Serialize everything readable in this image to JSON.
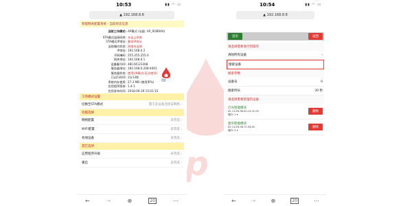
{
  "phone1": {
    "time": "10:53",
    "url": "192.168.8.8",
    "title": "智能网关配置系统 - 当前状态信息",
    "mode_label": "当前工作模式:",
    "mode_value": "AP模式 (长配: AP_ROBRA0)",
    "kv": [
      {
        "k": "STA模式连接网关:",
        "v": "未连上网关",
        "red": true
      },
      {
        "k": "STA模式IP地址:",
        "v": "静态IP地址",
        "red": true
      },
      {
        "k": "当前端口状态:",
        "v": "网络未连接",
        "red": true
      },
      {
        "k": "IP地址:",
        "v": "192.168.0.2",
        "red": false
      },
      {
        "k": "子网掩码:",
        "v": "255.255.255.0",
        "red": false
      },
      {
        "k": "网关地址:",
        "v": "192.168.0.1",
        "red": false
      },
      {
        "k": "设备编号ID:",
        "v": "48C44123308",
        "red": false
      },
      {
        "k": "服务器地址:",
        "v": "192.168.0.248:4001",
        "red": false
      },
      {
        "k": "服务器状态:",
        "v": "使用UN模式(无法使用)",
        "red": true
      },
      {
        "k": "已运行时间:",
        "v": "2分13秒",
        "red": false
      },
      {
        "k": "系统内存使用:",
        "v": "27.3 MB (使用率%)",
        "red": false
      },
      {
        "k": "应用程序版本:",
        "v": "1.4-1",
        "red": false
      },
      {
        "k": "应用发布时间:",
        "v": "2018-06-19 15:01:15",
        "red": false
      }
    ],
    "sec_work": "工作模式设置",
    "switch_label": "切换至STA模式",
    "switch_value": "需于此设备连接该网络 ›",
    "sec_func": "功能选择",
    "func_rows": [
      {
        "label": "网络配置",
        "value": "未完成 ›"
      },
      {
        "label": "WIFI配置",
        "value": "未完成 ›"
      },
      {
        "label": "有线设备",
        "value": "未完成 ›"
      }
    ],
    "sec_other": "其它选项",
    "other_rows": [
      {
        "label": "应用程序升级",
        "value": "未完成 ›"
      },
      {
        "label": "重启",
        "value": "未完成 ›"
      }
    ]
  },
  "phone2": {
    "time": "10:54",
    "url": "192.168.8.8",
    "btn_home": "首页",
    "btn_back": "返回",
    "h_action": "请选择需要进行的操作",
    "rows_action": [
      {
        "label": "清除所有设备",
        "value": "›",
        "selected": false
      },
      {
        "label": "搜索设备",
        "value": "",
        "selected": true
      }
    ],
    "h_params": "搜索参数",
    "rows_params": [
      {
        "label": "设备号",
        "value": "0"
      },
      {
        "label": "搜索时长",
        "value": "30 秒"
      }
    ],
    "h_devices": "请选择需要管理的设备",
    "devices": [
      {
        "name": "灯光智能模块",
        "detail1": "ID: C4-F6-98-00-C4-1F-00",
        "detail2": "端口: 1 ▾",
        "btn": "删除"
      },
      {
        "name": "窗帘智能模块",
        "detail1": "ID: C4-F6-98-7C-06-9C",
        "detail2": "端口: 2 ▾",
        "btn": "删除"
      }
    ]
  },
  "bottom_icons": [
    "back-icon",
    "forward-icon",
    "plus-icon",
    "tabs-icon",
    "more-icon"
  ],
  "colors": {
    "green": "#2e7d32",
    "red": "#e53935",
    "yellow": "#fff9c4",
    "watermark": "#e53935"
  }
}
